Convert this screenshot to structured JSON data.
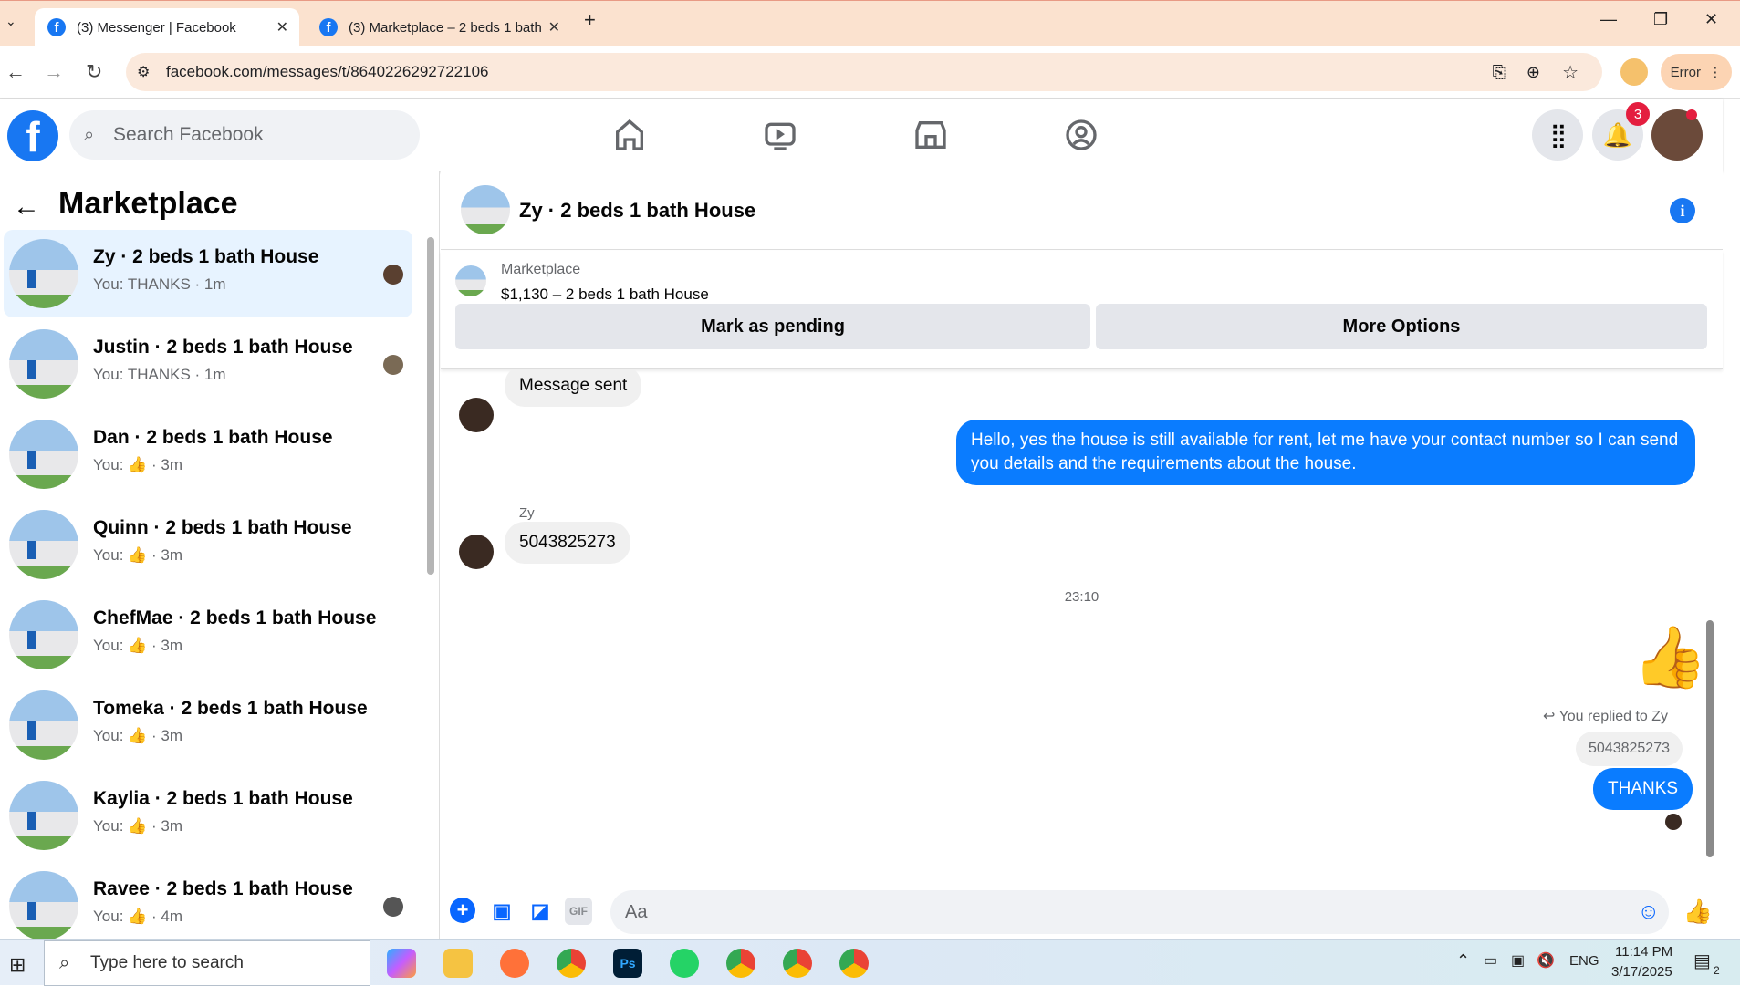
{
  "browser": {
    "tabs": [
      {
        "title": "(3) Messenger | Facebook",
        "active": true
      },
      {
        "title": "(3) Marketplace – 2 beds 1 bath",
        "active": false
      }
    ],
    "url": "facebook.com/messages/t/8640226292722106",
    "profile_status": "Error"
  },
  "fb": {
    "search_placeholder": "Search Facebook",
    "notification_count": "3",
    "nav_icons": [
      "home-icon",
      "watch-icon",
      "marketplace-icon",
      "groups-icon"
    ]
  },
  "sidebar": {
    "title": "Marketplace",
    "conversations": [
      {
        "name": "Zy · 2 beds 1 bath House",
        "preview": "You: THANKS · 1m"
      },
      {
        "name": "Justin · 2 beds 1 bath House",
        "preview": "You: THANKS · 1m"
      },
      {
        "name": "Dan · 2 beds 1 bath House",
        "preview": "You: 👍 · 3m"
      },
      {
        "name": "Quinn · 2 beds 1 bath House",
        "preview": "You: 👍 · 3m"
      },
      {
        "name": "ChefMae · 2 beds 1 bath House",
        "preview": "You: 👍 · 3m"
      },
      {
        "name": "Tomeka · 2 beds 1 bath House",
        "preview": "You: 👍 · 3m"
      },
      {
        "name": "Kaylia · 2 beds 1 bath House",
        "preview": "You: 👍 · 3m"
      },
      {
        "name": "Ravee · 2 beds 1 bath House",
        "preview": "You: 👍 · 4m"
      }
    ]
  },
  "chat": {
    "title": "Zy · 2 beds 1 bath House",
    "marketplace_label": "Marketplace",
    "listing": "$1,130 – 2 beds 1 bath House",
    "mark_pending": "Mark as pending",
    "more_options": "More Options",
    "messages": {
      "m1": "Message sent",
      "m2": "Hello, yes the house is still available for rent, let me have your contact number so I can send you details and the requirements about the house.",
      "sender": "Zy",
      "m3": "5043825273",
      "time": "23:10",
      "replied": "You replied to Zy",
      "quoted": "5043825273",
      "m4": "THANKS"
    },
    "input_placeholder": "Aa"
  },
  "taskbar": {
    "search_placeholder": "Type here to search",
    "lang": "ENG",
    "time": "11:14 PM",
    "date": "3/17/2025",
    "notif": "2"
  },
  "colors": {
    "accent": "#0866ff",
    "bubble_out": "#0a7cff",
    "fb_blue": "#1877f2"
  }
}
